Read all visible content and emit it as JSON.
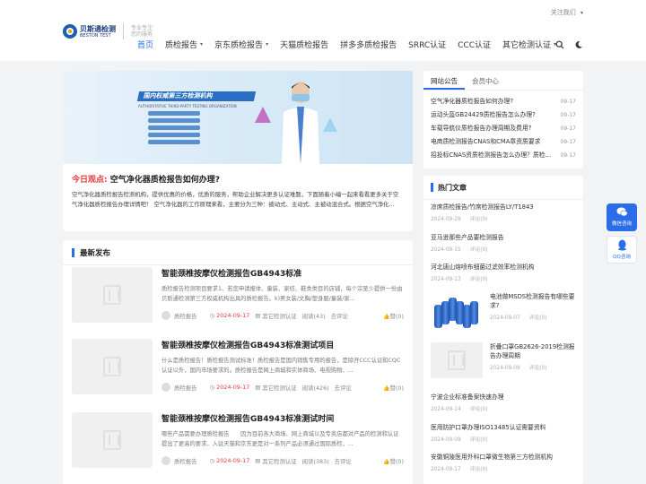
{
  "header": {
    "follow_label": "关注我们",
    "logo_cn": "贝斯通检测",
    "logo_en": "BESTON TEST",
    "slogan_1": "专业专注",
    "slogan_2": "您的服务"
  },
  "nav": [
    {
      "label": "首页",
      "active": true,
      "dropdown": false
    },
    {
      "label": "质检报告",
      "active": false,
      "dropdown": true
    },
    {
      "label": "京东质检报告",
      "active": false,
      "dropdown": true
    },
    {
      "label": "天猫质检报告",
      "active": false,
      "dropdown": false
    },
    {
      "label": "拼多多质检报告",
      "active": false,
      "dropdown": false
    },
    {
      "label": "SRRC认证",
      "active": false,
      "dropdown": false
    },
    {
      "label": "CCC认证",
      "active": false,
      "dropdown": false
    },
    {
      "label": "其它检测认证",
      "active": false,
      "dropdown": true
    }
  ],
  "icons": {
    "search": "search-icon",
    "theme": "moon-icon"
  },
  "banner": {
    "title": "国内权威第三方检测机构",
    "subtitle": "AUTHORITATIVE THIRD-PARTY TESTING ORGANIZATION"
  },
  "intro": {
    "prefix": "今日观点:",
    "headline": "空气净化器质检报告如何办理?",
    "body": "空气净化器质检报告检测机构，提供优惠的价格，优质的服务，帮助企业解决更多认证难题，下面随着小编一起来看看更多关于空气净化器质检报告办理详情吧！ 空气净化器的工作原理来看，主要分为三种：被动式、主动式、主被动混合式。根据空气净化..."
  },
  "latest": {
    "heading": "最新发布",
    "posts": [
      {
        "title": "智能颈椎按摩仪检测报告GB4943标准",
        "excerpt": "质检报告检测项目要求1、若您申请报体、童装、家纺、鞋类类目的店铺，每个宗至少提供一份由贝斯通检测第三方权威机构出具的质检报告。k)男女装/文胸/塑身服/童装/家...",
        "author": "质检报告",
        "date": "2024-09-17",
        "category": "其它检测认证",
        "reads": "阅读(43)",
        "comment": "去评论",
        "likes": "赞(0)"
      },
      {
        "title": "智能颈椎按摩仪检测报告GB4943标准测试项目",
        "excerpt": "什么是质检报告！质检报告测试标准！质检报告是国内销售专用的报告，是除开CCC认证和CQC认证以外，国内市场要求的。质检报告是网上商城和实体商场、电视购物、...",
        "author": "质检报告",
        "date": "2024-09-17",
        "category": "其它检测认证",
        "reads": "阅读(426)",
        "comment": "去评论",
        "likes": "赞(0)"
      },
      {
        "title": "智能颈椎按摩仪检测报告GB4943标准测试时间",
        "excerpt": "哪些产品需要办理质检报告　　因为目前各大商场、网上商城以及专卖店都对产品的检测和认证提出了更高的要求，入驻天猫和京东更是对一系列产品必须通过国际质检，...",
        "author": "质检报告",
        "date": "2024-09-17",
        "category": "其它检测认证",
        "reads": "阅读(383)",
        "comment": "去评论",
        "likes": "赞(0)"
      }
    ]
  },
  "sidebar": {
    "tabs": [
      {
        "label": "网站公告",
        "active": true
      },
      {
        "label": "会员中心",
        "active": false
      }
    ],
    "notices": [
      {
        "title": "空气净化器质检报告如何办理?",
        "date": "09-17"
      },
      {
        "title": "运动头盔GB24429质检报告怎么办理?",
        "date": "09-17"
      },
      {
        "title": "车载导航仪质检报告办理周期及费用?",
        "date": "09-17"
      },
      {
        "title": "电商质检测报告CNAS和CMA章资质要求",
        "date": "09-17"
      },
      {
        "title": "招投标CNAS资质检测报告怎么办理？质检...",
        "date": "09-17"
      }
    ],
    "hot_heading": "热门文章",
    "hot": [
      {
        "title": "凉席质检报告/竹席检测报告LY/T1843",
        "date": "2024-09-28",
        "comment": "评论(0)",
        "image": false
      },
      {
        "title": "亚马逊那些产品要检测报告",
        "date": "2024-09-15",
        "comment": "评论(0)",
        "image": false
      },
      {
        "title": "河北唐山熔喷布细菌过滤效率检测机构",
        "date": "2024-09-13",
        "comment": "评论(0)",
        "image": false
      },
      {
        "title": "电池做MSDS检测报告有哪些要求?",
        "date": "2024-09-07",
        "comment": "评论(0)",
        "image": "batteries"
      },
      {
        "title": "折叠口罩GB2626-2019检测报告办理周期",
        "date": "2024-09-09",
        "comment": "评论(0)",
        "image": "placeholder"
      },
      {
        "title": "宁波企业标准备案快速办理",
        "date": "2024-09-14",
        "comment": "评论(0)",
        "image": false
      },
      {
        "title": "医用防护口罩办理ISO13485认证需要资料",
        "date": "2024-09-09",
        "comment": "评论(0)",
        "image": false
      },
      {
        "title": "安徽铜陵医用外科口罩微生物第三方检测机构",
        "date": "2024-09-17",
        "comment": "评论(0)",
        "image": false
      }
    ]
  },
  "floating": {
    "wechat_label": "微信咨询",
    "qq_label": "QQ咨询"
  },
  "colors": {
    "accent": "#2b6de8",
    "highlight": "#e83a3a",
    "background": "#f2f3f5"
  }
}
